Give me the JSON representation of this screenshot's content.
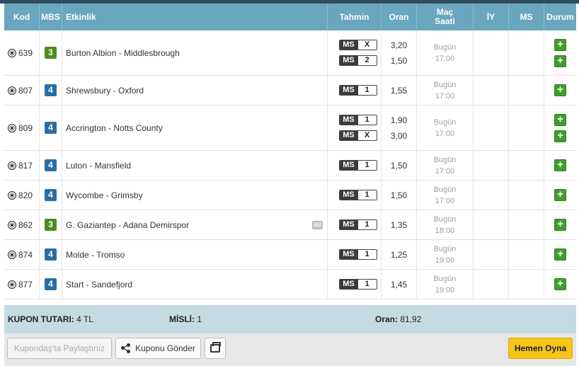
{
  "header": {
    "kod": "Kod",
    "mbs": "MBS",
    "etkinlik": "Etkinlik",
    "tahmin": "Tahmin",
    "oran": "Oran",
    "mac_saati": "Maç Saati",
    "iy": "İY",
    "ms": "MS",
    "durum": "Durum"
  },
  "rows": [
    {
      "kod": "639",
      "mbs": "3",
      "mbs_color": "#4c8c1c",
      "event": "Burton Albion - Middlesbrough",
      "tv": false,
      "picks": [
        {
          "k": "MS",
          "v": "X",
          "oran": "3,20"
        },
        {
          "k": "MS",
          "v": "2",
          "oran": "1,50"
        }
      ],
      "day": "Bugün",
      "time": "17:00"
    },
    {
      "kod": "807",
      "mbs": "4",
      "mbs_color": "#2a6ea6",
      "event": "Shrewsbury - Oxford",
      "tv": false,
      "picks": [
        {
          "k": "MS",
          "v": "1",
          "oran": "1,55"
        }
      ],
      "day": "Bugün",
      "time": "17:00"
    },
    {
      "kod": "809",
      "mbs": "4",
      "mbs_color": "#2a6ea6",
      "event": "Accrington - Notts County",
      "tv": false,
      "picks": [
        {
          "k": "MS",
          "v": "1",
          "oran": "1,90"
        },
        {
          "k": "MS",
          "v": "X",
          "oran": "3,00"
        }
      ],
      "day": "Bugün",
      "time": "17:00"
    },
    {
      "kod": "817",
      "mbs": "4",
      "mbs_color": "#2a6ea6",
      "event": "Luton - Mansfield",
      "tv": false,
      "picks": [
        {
          "k": "MS",
          "v": "1",
          "oran": "1,50"
        }
      ],
      "day": "Bugün",
      "time": "17:00"
    },
    {
      "kod": "820",
      "mbs": "4",
      "mbs_color": "#2a6ea6",
      "event": "Wycombe - Grimsby",
      "tv": false,
      "picks": [
        {
          "k": "MS",
          "v": "1",
          "oran": "1,50"
        }
      ],
      "day": "Bugün",
      "time": "17:00"
    },
    {
      "kod": "862",
      "mbs": "3",
      "mbs_color": "#4c8c1c",
      "event": "G. Gaziantep - Adana Demirspor",
      "tv": true,
      "picks": [
        {
          "k": "MS",
          "v": "1",
          "oran": "1,35"
        }
      ],
      "day": "Bugün",
      "time": "18:00"
    },
    {
      "kod": "874",
      "mbs": "4",
      "mbs_color": "#2a6ea6",
      "event": "Molde - Tromso",
      "tv": false,
      "picks": [
        {
          "k": "MS",
          "v": "1",
          "oran": "1,25"
        }
      ],
      "day": "Bugün",
      "time": "19:00"
    },
    {
      "kod": "877",
      "mbs": "4",
      "mbs_color": "#2a6ea6",
      "event": "Start - Sandefjord",
      "tv": false,
      "picks": [
        {
          "k": "MS",
          "v": "1",
          "oran": "1,45"
        }
      ],
      "day": "Bugün",
      "time": "19:00"
    }
  ],
  "summary": {
    "tutar_label": "KUPON TUTARI:",
    "tutar_value": "4 TL",
    "misli_label": "MİSLİ:",
    "misli_value": "1",
    "oran_label": "Oran:",
    "oran_value": "81,92"
  },
  "footer": {
    "share_placeholder": "Kupondaş'ta Paylaştınız",
    "send_label": "Kuponu Gönder",
    "play_label": "Hemen Oyna"
  },
  "icons": {
    "sport": "soccer-ball-icon",
    "tv": "tv-icon",
    "add": "plus-icon",
    "share": "share-icon",
    "print": "print-icon"
  },
  "colors": {
    "header_bg": "#6aa6bd",
    "summary_bg": "#c5dbe4",
    "add_button": "#3f9d2c",
    "play_button": "#f5c518"
  }
}
